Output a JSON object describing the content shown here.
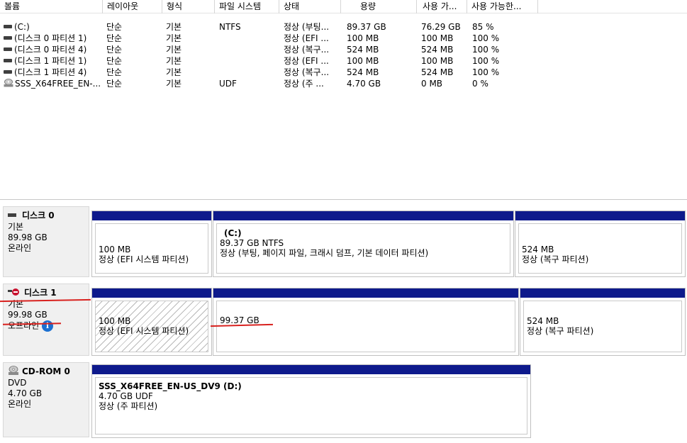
{
  "volume_list": {
    "columns": [
      "볼륨",
      "레이아웃",
      "형식",
      "파일 시스템",
      "상태",
      "용량",
      "사용 가...",
      "사용 가능한..."
    ],
    "rows": [
      {
        "icon": "drive-icon",
        "volume": "(C:)",
        "layout": "단순",
        "type": "기본",
        "fs": "NTFS",
        "status": "정상 (부팅...",
        "capacity": "89.37 GB",
        "free": "76.29 GB",
        "pct": "85 %"
      },
      {
        "icon": "drive-icon",
        "volume": "(디스크 0 파티션 1)",
        "layout": "단순",
        "type": "기본",
        "fs": "",
        "status": "정상 (EFI ...",
        "capacity": "100 MB",
        "free": "100 MB",
        "pct": "100 %"
      },
      {
        "icon": "drive-icon",
        "volume": "(디스크 0 파티션 4)",
        "layout": "단순",
        "type": "기본",
        "fs": "",
        "status": "정상 (복구...",
        "capacity": "524 MB",
        "free": "524 MB",
        "pct": "100 %"
      },
      {
        "icon": "drive-icon",
        "volume": "(디스크 1 파티션 1)",
        "layout": "단순",
        "type": "기본",
        "fs": "",
        "status": "정상 (EFI ...",
        "capacity": "100 MB",
        "free": "100 MB",
        "pct": "100 %"
      },
      {
        "icon": "drive-icon",
        "volume": "(디스크 1 파티션 4)",
        "layout": "단순",
        "type": "기본",
        "fs": "",
        "status": "정상 (복구...",
        "capacity": "524 MB",
        "free": "524 MB",
        "pct": "100 %"
      },
      {
        "icon": "cd-icon",
        "volume": "SSS_X64FREE_EN-...",
        "layout": "단순",
        "type": "기본",
        "fs": "UDF",
        "status": "정상 (주 ...",
        "capacity": "4.70 GB",
        "free": "0 MB",
        "pct": "0 %"
      }
    ]
  },
  "disks": {
    "disk0": {
      "name": "디스크 0",
      "type": "기본",
      "size": "89.98 GB",
      "state": "온라인",
      "p1": {
        "size": "100 MB",
        "status": "정상 (EFI 시스템 파티션)"
      },
      "p2": {
        "label": "(C:)",
        "size": "89.37 GB NTFS",
        "status": "정상 (부팅, 페이지 파일, 크래시 덤프, 기본 데이터 파티션)"
      },
      "p3": {
        "size": "524 MB",
        "status": "정상 (복구 파티션)"
      }
    },
    "disk1": {
      "name": "디스크 1",
      "type": "기본",
      "size": "99.98 GB",
      "state": "오프라인",
      "p1": {
        "size": "100 MB",
        "status": "정상 (EFI 시스템 파티션)"
      },
      "p2": {
        "size": "99.37 GB"
      },
      "p3": {
        "size": "524 MB",
        "status": "정상 (복구 파티션)"
      }
    },
    "cdrom0": {
      "name": "CD-ROM 0",
      "type": "DVD",
      "size": "4.70 GB",
      "state": "온라인",
      "p1": {
        "label": "SSS_X64FREE_EN-US_DV9  (D:)",
        "size": "4.70 GB UDF",
        "status": "정상 (주 파티션)"
      }
    }
  },
  "colors": {
    "partition_bar": "#0e1a8c",
    "annotation": "#d8221f",
    "info_icon": "#1b6fd1"
  }
}
